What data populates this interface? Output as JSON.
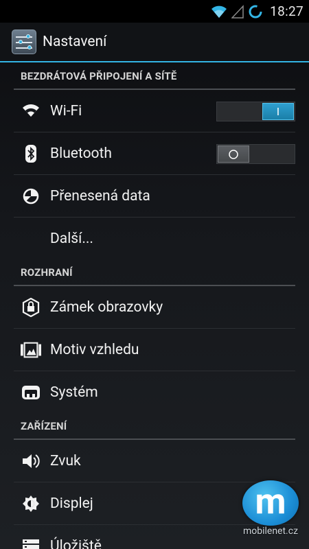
{
  "status_bar": {
    "time": "18:27",
    "icons": [
      "wifi-icon",
      "signal-icon",
      "sync-icon"
    ]
  },
  "action_bar": {
    "icon": "settings-app-icon",
    "title": "Nastavení"
  },
  "sections": [
    {
      "header": "BEZDRÁTOVÁ PŘIPOJENÍ A SÍTĚ",
      "items": [
        {
          "label": "Wi-Fi",
          "icon": "wifi-icon",
          "toggle": "on",
          "toggle_glyph": "I"
        },
        {
          "label": "Bluetooth",
          "icon": "bluetooth-icon",
          "toggle": "off",
          "toggle_glyph": "O"
        },
        {
          "label": "Přenesená data",
          "icon": "data-usage-icon"
        },
        {
          "label": "Další...",
          "icon": ""
        }
      ]
    },
    {
      "header": "ROZHRANÍ",
      "items": [
        {
          "label": "Zámek obrazovky",
          "icon": "lock-icon"
        },
        {
          "label": "Motiv vzhledu",
          "icon": "theme-icon"
        },
        {
          "label": "Systém",
          "icon": "system-icon"
        }
      ]
    },
    {
      "header": "ZAŘÍZENÍ",
      "items": [
        {
          "label": "Zvuk",
          "icon": "speaker-icon"
        },
        {
          "label": "Displej",
          "icon": "display-brightness-icon"
        },
        {
          "label": "Úložiště",
          "icon": "storage-icon"
        }
      ]
    }
  ],
  "watermark": {
    "text": "mobilenet.cz"
  },
  "colors": {
    "accent": "#33b5e5",
    "background": "#15171b",
    "divider": "#4c4f53"
  }
}
